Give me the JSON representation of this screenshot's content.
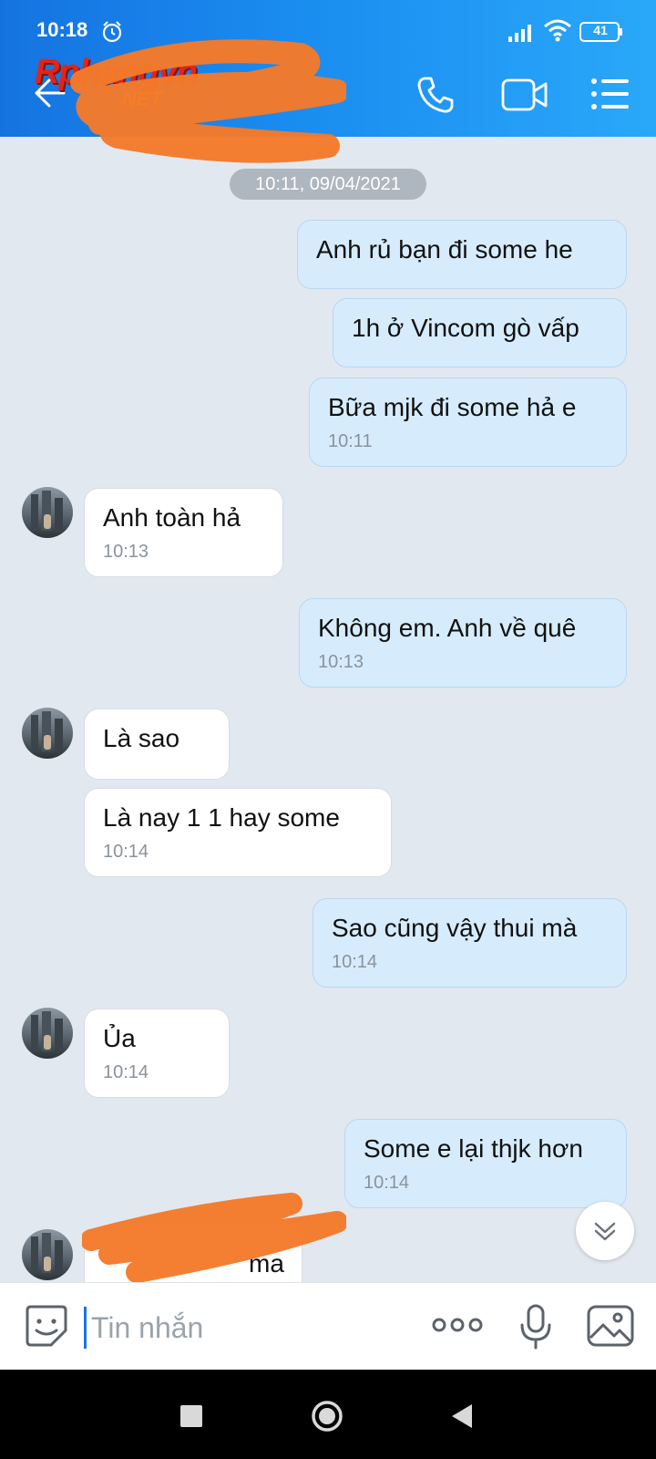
{
  "status_bar": {
    "time": "10:18",
    "battery": "41"
  },
  "header": {
    "logo_main": "Rphangvn",
    "logo_sub": ".NET"
  },
  "chat": {
    "date": "10:11, 09/04/2021",
    "messages": [
      {
        "dir": "out",
        "text": "Anh rủ bạn đi some he",
        "time": ""
      },
      {
        "dir": "out",
        "text": "1h ở Vincom gò vấp",
        "time": ""
      },
      {
        "dir": "out",
        "text": "Bữa mjk đi some hả e",
        "time": "10:11"
      },
      {
        "dir": "in",
        "text": "Anh toàn hả",
        "time": "10:13"
      },
      {
        "dir": "out",
        "text": "Không em. Anh về quê",
        "time": "10:13"
      },
      {
        "dir": "in",
        "text": "Là sao",
        "time": ""
      },
      {
        "dir": "in",
        "text": "Là nay 1 1 hay some",
        "time": "10:14"
      },
      {
        "dir": "out",
        "text": "Sao cũng vậy thui mà",
        "time": "10:14"
      },
      {
        "dir": "in",
        "text": "Ủa",
        "time": "10:14"
      },
      {
        "dir": "out",
        "text": "Some e lại thjk hơn",
        "time": "10:14"
      },
      {
        "dir": "in",
        "text": "ma",
        "time": ""
      }
    ]
  },
  "input": {
    "placeholder": "Tin nhắn"
  },
  "colors": {
    "header_start": "#1573e0",
    "header_end": "#29a8f9",
    "bubble_out": "#d6ecfc",
    "bubble_in": "#ffffff",
    "scribble": "#f47a2a"
  },
  "icons": [
    "back-arrow-icon",
    "phone-icon",
    "video-icon",
    "menu-icon",
    "chevrons-down-icon",
    "sticker-icon",
    "more-icon",
    "mic-icon",
    "image-icon"
  ]
}
